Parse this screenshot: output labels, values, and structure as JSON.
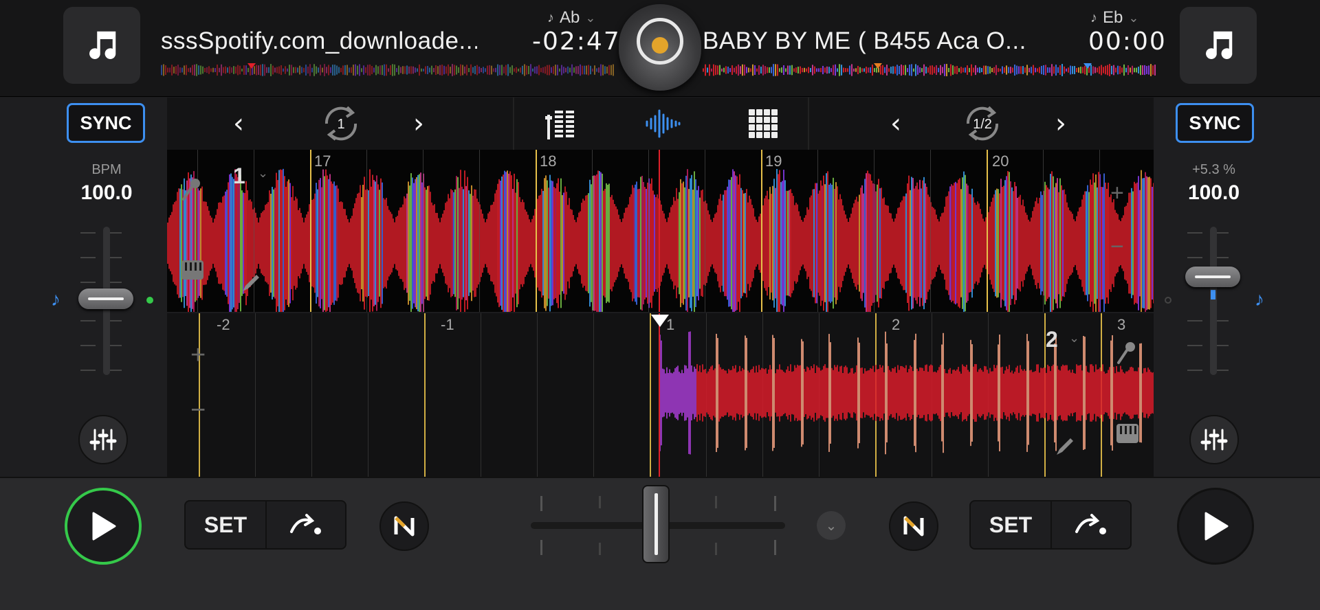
{
  "deck_left": {
    "track_title": "sssSpotify.com_downloade...",
    "key": "Ab",
    "time": "-02:47",
    "sync_label": "SYNC",
    "bpm_label": "BPM",
    "bpm_value": "100.0",
    "loop_length": "1",
    "deck_number": "1",
    "beat_markers": [
      "17",
      "18",
      "19",
      "20"
    ],
    "playing": true
  },
  "deck_right": {
    "track_title": "BABY BY ME ( B455 Aca O...",
    "key": "Eb",
    "time": "00:00",
    "sync_label": "SYNC",
    "pitch_label": "+5.3 %",
    "bpm_value": "100.0",
    "loop_length": "1/2",
    "deck_number": "2",
    "beat_markers": [
      "-2",
      "-1",
      "1",
      "2",
      "3"
    ],
    "playing": false
  },
  "bottom": {
    "set_label_left": "SET",
    "set_label_right": "SET"
  },
  "icons": {
    "artwork": "music-note-icon",
    "play": "play-icon",
    "cue_jump": "cue-jump-icon",
    "neural_mix": "neural-mix-icon",
    "eq": "eq-sliders-icon",
    "mixer": "mixer-icon",
    "waveform": "waveform-icon",
    "pads": "pads-grid-icon"
  },
  "colors": {
    "accent_blue": "#3d8ff0",
    "play_active": "#35c94a",
    "waveform_red": "#e0202a",
    "key_marker_orange": "#e87d20"
  }
}
